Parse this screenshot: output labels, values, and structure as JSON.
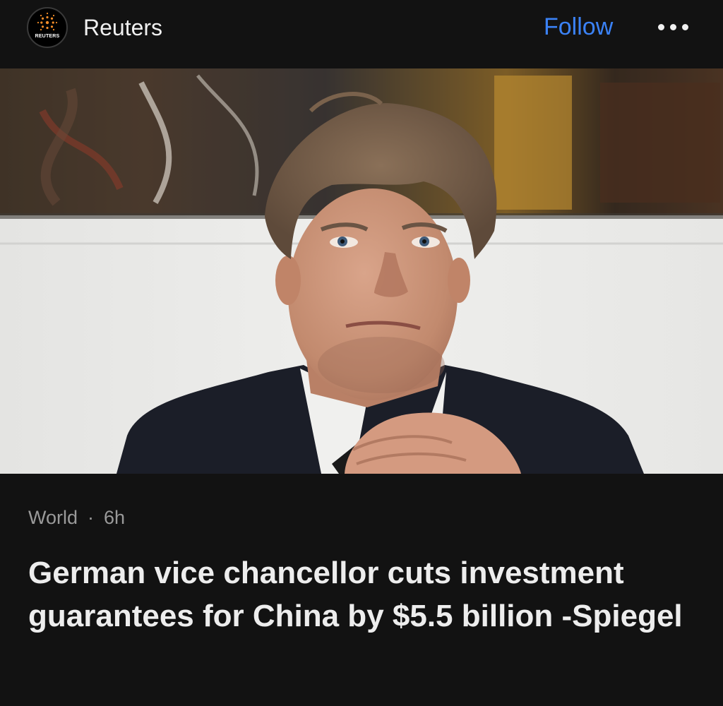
{
  "header": {
    "logo_text": "REUTERS",
    "logo_icon": "reuters-dot-logo",
    "publisher_name": "Reuters",
    "follow_label": "Follow",
    "more_icon": "ellipsis-icon",
    "follow_color": "#3b82f6"
  },
  "article": {
    "image_description_icon": "news-photo",
    "category": "World",
    "separator": "·",
    "age": "6h",
    "headline": "German vice chancellor cuts investment guarantees for China by $5.5 billion -Spiegel"
  }
}
